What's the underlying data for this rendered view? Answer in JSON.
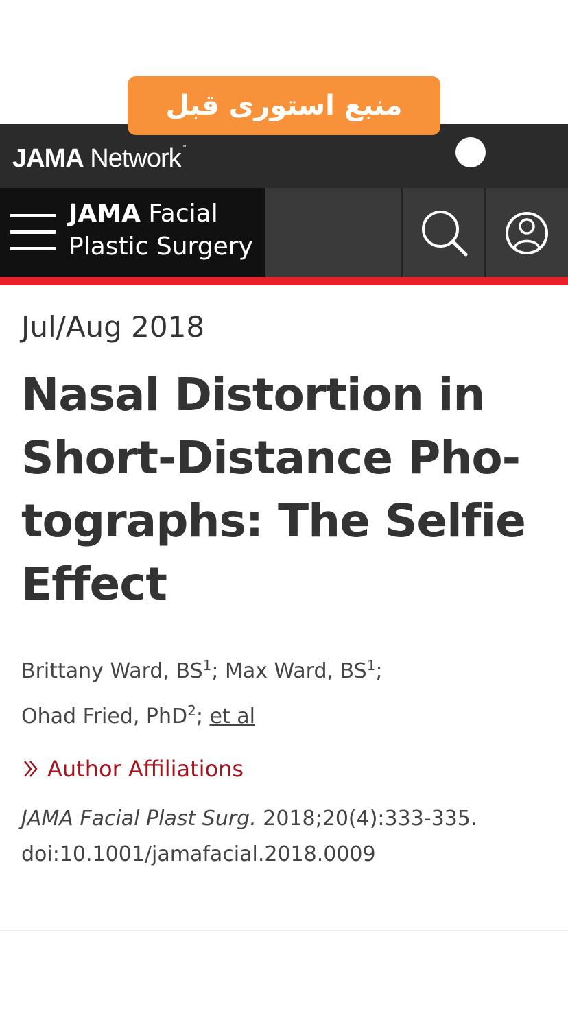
{
  "story_label": "منبع استوری قبل",
  "network": {
    "brand_bold": "JAMA",
    "brand_light": "Network",
    "trademark": "™"
  },
  "journal": {
    "name_bold": "JAMA",
    "name_rest": "Facial",
    "name_line2": "Plastic Surgery"
  },
  "icons": {
    "menu": "hamburger-menu-icon",
    "search": "search-icon",
    "account": "user-account-icon",
    "affiliation": "double-chevron-right-icon"
  },
  "article": {
    "issue_date": "Jul/Aug 2018",
    "title": "Nasal Distortion in Short-Distance Pho-tographs: The Selfie Effect",
    "authors": [
      {
        "name": "Brittany Ward, BS",
        "sup": "1"
      },
      {
        "name": "Max Ward, BS",
        "sup": "1"
      },
      {
        "name": "Ohad Fried, PhD",
        "sup": "2"
      }
    ],
    "et_al": "et al",
    "affiliations_label": "Author Affiliations",
    "citation_journal": "JAMA Facial Plast Surg.",
    "citation_details": "2018;20(4):333-335.",
    "doi": "doi:10.1001/jamafacial.2018.0009"
  },
  "colors": {
    "accent_red": "#e8202a",
    "link_red": "#a3141d",
    "story_orange": "#f7923a",
    "header_dark": "#2b2b2b"
  }
}
